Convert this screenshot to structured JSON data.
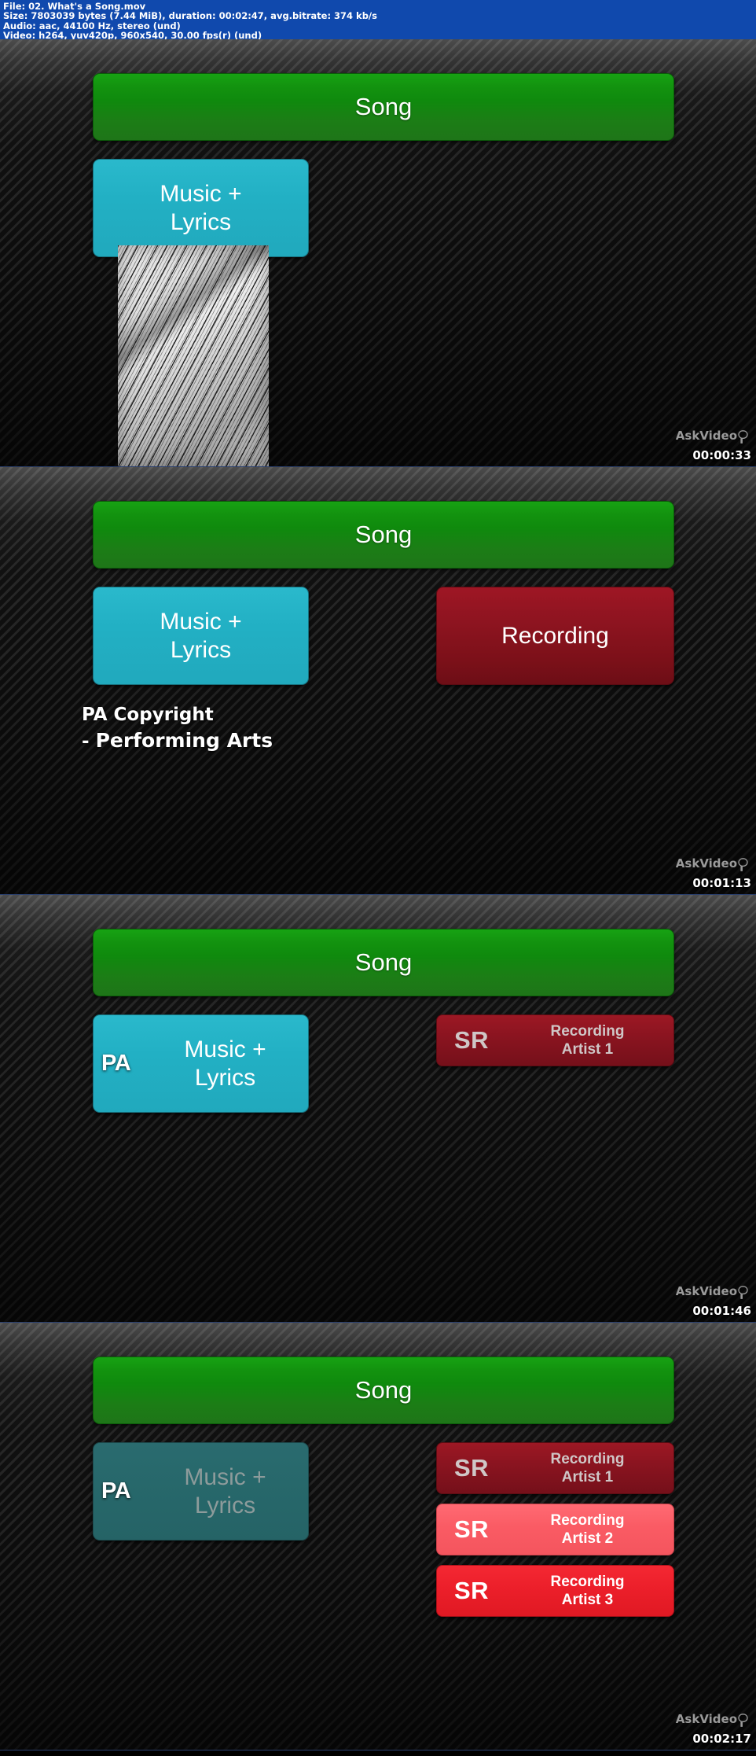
{
  "header": {
    "lines": [
      "File:  02. What's a Song.mov",
      "Size: 7803039 bytes (7.44 MiB), duration: 00:02:47, avg.bitrate: 374 kb/s",
      "Audio: aac, 44100 Hz, stereo (und)",
      "Video: h264, yuv420p, 960x540, 30.00 fps(r) (und)"
    ],
    "background_color": "#1049ad",
    "text_color": "#ffffff"
  },
  "watermark": {
    "text": "AskVideo",
    "icon": "speech-balloon-icon",
    "color": "#9a9a9a"
  },
  "colors": {
    "song_green": "#13930f",
    "music_cyan": "#22b0c4",
    "music_cyan_dim": "#27686b",
    "recording_dark_red": "#8e1420",
    "recording_light_red": "#fa5b64",
    "recording_bright_red": "#ec1f2a",
    "panel_background": "#0a0a0a"
  },
  "frames": [
    {
      "timestamp": "00:00:33",
      "song_label": "Song",
      "music_label": "Music +\nLyrics",
      "music_line1": "Music +",
      "music_line2": "Lyrics",
      "photo": "sheet-music-photo"
    },
    {
      "timestamp": "00:01:13",
      "song_label": "Song",
      "music_line1": "Music +",
      "music_line2": "Lyrics",
      "recording_label": "Recording",
      "caption_line1": "PA Copyright",
      "caption_line2_prefix": "- ",
      "caption_line2": "Performing Arts"
    },
    {
      "timestamp": "00:01:46",
      "song_label": "Song",
      "music_line1": "Music +",
      "music_line2": "Lyrics",
      "pa_badge": "PA",
      "sr_items": [
        {
          "tag": "SR",
          "line1": "Recording",
          "line2": "Artist 1",
          "style": "dark"
        }
      ]
    },
    {
      "timestamp": "00:02:17",
      "song_label": "Song",
      "music_line1": "Music +",
      "music_line2": "Lyrics",
      "pa_badge": "PA",
      "sr_items": [
        {
          "tag": "SR",
          "line1": "Recording",
          "line2": "Artist 1",
          "style": "dark"
        },
        {
          "tag": "SR",
          "line1": "Recording",
          "line2": "Artist 2",
          "style": "light"
        },
        {
          "tag": "SR",
          "line1": "Recording",
          "line2": "Artist 3",
          "style": "bright"
        }
      ]
    }
  ]
}
